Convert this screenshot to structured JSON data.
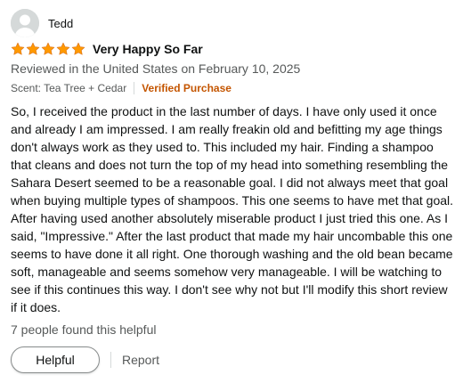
{
  "reviewer": {
    "name": "Tedd",
    "avatar_icon": "default-user-avatar-icon"
  },
  "rating": {
    "stars": 5,
    "max": 5,
    "color": "#ff9900"
  },
  "title": "Very Happy So Far",
  "date_line": "Reviewed in the United States on February 10, 2025",
  "variant": "Scent: Tea Tree + Cedar",
  "badge": "Verified Purchase",
  "body": "So, I received the product in the last number of days. I have only used it once and already I am impressed. I am really freakin old and befitting my age things don't always work as they used to. This included my hair. Finding a shampoo that cleans and does not turn the top of my head into something resembling the Sahara Desert seemed to be a reasonable goal. I did not always meet that goal when buying multiple types of shampoos. This one seems to have met that goal. After having used another absolutely miserable product I just tried this one. As I said, \"Impressive.\" After the last product that made my hair uncombable this one seems to have done it all right. One thorough washing and the old bean became soft, manageable and seems somehow very manageable. I will be watching to see if this continues this way. I don't see why not but I'll modify this short review if it does.",
  "helpful_count": "7 people found this helpful",
  "actions": {
    "helpful_label": "Helpful",
    "report_label": "Report"
  },
  "colors": {
    "verified": "#c45500",
    "muted": "#565959",
    "text": "#0f1111"
  }
}
